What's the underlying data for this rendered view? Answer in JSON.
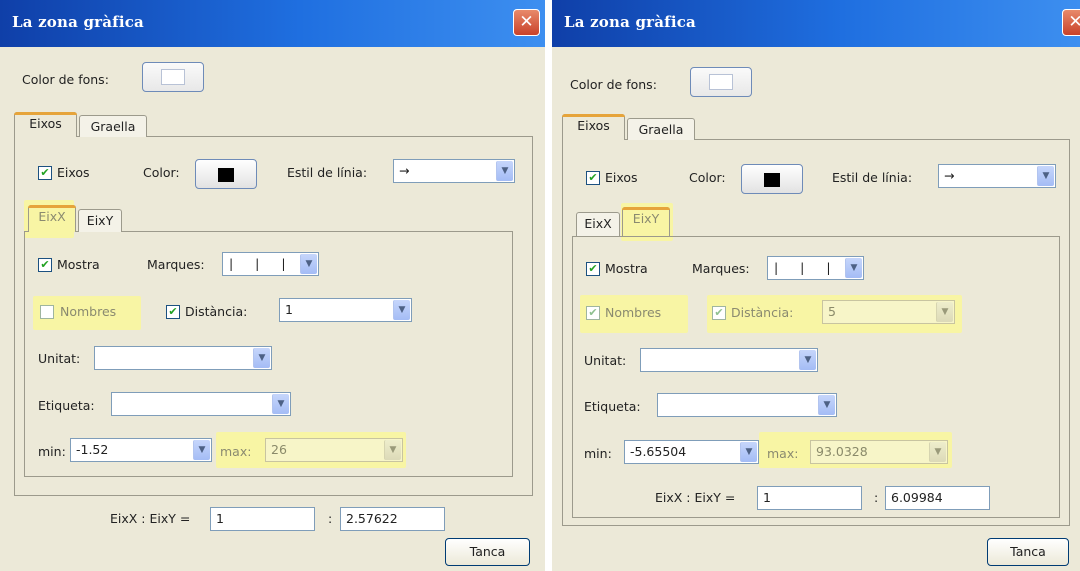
{
  "dialogs": [
    {
      "title": "La zona gràfica",
      "close_icon": "✕",
      "background_color_label": "Color de fons:",
      "tabs": [
        "Eixos",
        "Graella"
      ],
      "axes_checkbox": "Eixos",
      "axes_checked": true,
      "color_label": "Color:",
      "line_style_label": "Estil de línia:",
      "line_style_value": "→",
      "subtabs": [
        "EixX",
        "EixY"
      ],
      "active_subtab": "EixX",
      "show_label": "Mostra",
      "show_checked": true,
      "ticks_label": "Marques:",
      "ticks_value": "| | |",
      "numbers_label": "Nombres",
      "numbers_checked": false,
      "distance_label": "Distància:",
      "distance_checked": true,
      "distance_value": "1",
      "unit_label": "Unitat:",
      "unit_value": "",
      "label_label": "Etiqueta:",
      "label_value": "",
      "min_label": "min:",
      "min_value": "-1.52",
      "max_label": "max:",
      "max_value": "26",
      "ratio_label": "EixX : EixY =",
      "ratio_x": "1",
      "ratio_sep": ":",
      "ratio_y": "2.57622",
      "close_button": "Tanca"
    },
    {
      "title": "La zona gràfica",
      "close_icon": "✕",
      "background_color_label": "Color de fons:",
      "tabs": [
        "Eixos",
        "Graella"
      ],
      "axes_checkbox": "Eixos",
      "axes_checked": true,
      "color_label": "Color:",
      "line_style_label": "Estil de línia:",
      "line_style_value": "→",
      "subtabs": [
        "EixX",
        "EixY"
      ],
      "active_subtab": "EixY",
      "show_label": "Mostra",
      "show_checked": true,
      "ticks_label": "Marques:",
      "ticks_value": "| | |",
      "numbers_label": "Nombres",
      "numbers_checked": true,
      "distance_label": "Distància:",
      "distance_checked": true,
      "distance_value": "5",
      "unit_label": "Unitat:",
      "unit_value": "",
      "label_label": "Etiqueta:",
      "label_value": "",
      "min_label": "min:",
      "min_value": "-5.65504",
      "max_label": "max:",
      "max_value": "93.0328",
      "ratio_label": "EixX : EixY =",
      "ratio_x": "1",
      "ratio_sep": ":",
      "ratio_y": "6.09984",
      "close_button": "Tanca"
    }
  ],
  "colors": {
    "titlebar": "#1f6fe0",
    "dialog_bg": "#ece9d8",
    "highlight": "#f8f5a4",
    "active_tab_accent": "#e6a43a",
    "close_button": "#c9422a"
  }
}
